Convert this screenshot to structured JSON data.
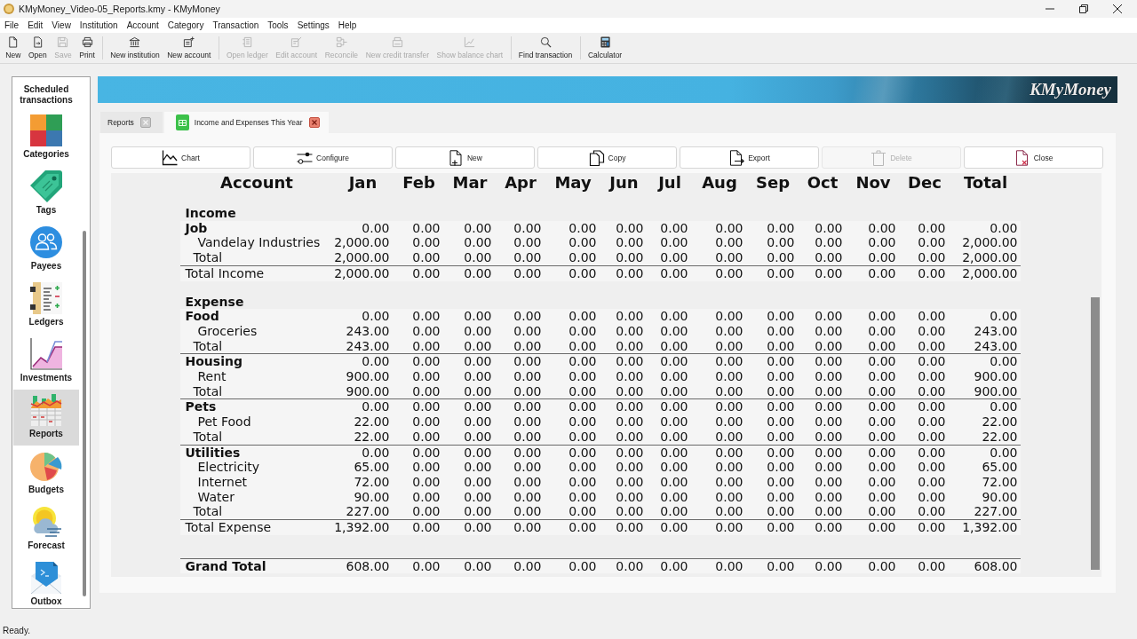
{
  "window": {
    "title": "KMyMoney_Video-05_Reports.kmy - KMyMoney"
  },
  "menu": [
    "File",
    "Edit",
    "View",
    "Institution",
    "Account",
    "Category",
    "Transaction",
    "Tools",
    "Settings",
    "Help"
  ],
  "toolbar": [
    [
      {
        "label": "New",
        "disabled": false
      },
      {
        "label": "Open",
        "disabled": false
      },
      {
        "label": "Save",
        "disabled": true
      },
      {
        "label": "Print",
        "disabled": false
      }
    ],
    [
      {
        "label": "New institution",
        "disabled": false
      },
      {
        "label": "New account",
        "disabled": false
      }
    ],
    [
      {
        "label": "Open ledger",
        "disabled": true
      },
      {
        "label": "Edit account",
        "disabled": true
      },
      {
        "label": "Reconcile",
        "disabled": true
      },
      {
        "label": "New credit transfer",
        "disabled": true
      },
      {
        "label": "Show balance chart",
        "disabled": true
      }
    ],
    [
      {
        "label": "Find transaction",
        "disabled": false
      }
    ],
    [
      {
        "label": "Calculator",
        "disabled": false
      }
    ]
  ],
  "sidebar": {
    "items": [
      {
        "label": "Scheduled transactions",
        "selected": false
      },
      {
        "label": "Categories",
        "selected": false
      },
      {
        "label": "Tags",
        "selected": false
      },
      {
        "label": "Payees",
        "selected": false
      },
      {
        "label": "Ledgers",
        "selected": false
      },
      {
        "label": "Investments",
        "selected": false
      },
      {
        "label": "Reports",
        "selected": true
      },
      {
        "label": "Budgets",
        "selected": false
      },
      {
        "label": "Forecast",
        "selected": false
      },
      {
        "label": "Outbox",
        "selected": false
      }
    ]
  },
  "banner": {
    "logo": "KMyMoney"
  },
  "tabs": [
    {
      "label": "Reports",
      "kind": "overview",
      "selected": false
    },
    {
      "label": "Income and Expenses This Year",
      "kind": "report",
      "selected": true
    }
  ],
  "report_buttons": [
    {
      "label": "Chart",
      "disabled": false
    },
    {
      "label": "Configure",
      "disabled": false
    },
    {
      "label": "New",
      "disabled": false
    },
    {
      "label": "Copy",
      "disabled": false
    },
    {
      "label": "Export",
      "disabled": false
    },
    {
      "label": "Delete",
      "disabled": true
    },
    {
      "label": "Close",
      "disabled": false
    }
  ],
  "report": {
    "columns": [
      "Account",
      "Jan",
      "Feb",
      "Mar",
      "Apr",
      "May",
      "Jun",
      "Jul",
      "Aug",
      "Sep",
      "Oct",
      "Nov",
      "Dec",
      "Total"
    ],
    "rows": [
      {
        "kind": "section",
        "label": "Income"
      },
      {
        "kind": "group",
        "label": "Job",
        "values": [
          "0.00",
          "0.00",
          "0.00",
          "0.00",
          "0.00",
          "0.00",
          "0.00",
          "0.00",
          "0.00",
          "0.00",
          "0.00",
          "0.00",
          "0.00"
        ]
      },
      {
        "kind": "item",
        "label": "Vandelay Industries",
        "values": [
          "2,000.00",
          "0.00",
          "0.00",
          "0.00",
          "0.00",
          "0.00",
          "0.00",
          "0.00",
          "0.00",
          "0.00",
          "0.00",
          "0.00",
          "2,000.00"
        ]
      },
      {
        "kind": "subtotal",
        "label": "Total",
        "values": [
          "2,000.00",
          "0.00",
          "0.00",
          "0.00",
          "0.00",
          "0.00",
          "0.00",
          "0.00",
          "0.00",
          "0.00",
          "0.00",
          "0.00",
          "2,000.00"
        ]
      },
      {
        "kind": "total",
        "label": "Total Income",
        "values": [
          "2,000.00",
          "0.00",
          "0.00",
          "0.00",
          "0.00",
          "0.00",
          "0.00",
          "0.00",
          "0.00",
          "0.00",
          "0.00",
          "0.00",
          "2,000.00"
        ]
      },
      {
        "kind": "section",
        "label": "Expense"
      },
      {
        "kind": "group",
        "label": "Food",
        "values": [
          "0.00",
          "0.00",
          "0.00",
          "0.00",
          "0.00",
          "0.00",
          "0.00",
          "0.00",
          "0.00",
          "0.00",
          "0.00",
          "0.00",
          "0.00"
        ]
      },
      {
        "kind": "item",
        "label": "Groceries",
        "values": [
          "243.00",
          "0.00",
          "0.00",
          "0.00",
          "0.00",
          "0.00",
          "0.00",
          "0.00",
          "0.00",
          "0.00",
          "0.00",
          "0.00",
          "243.00"
        ]
      },
      {
        "kind": "subtotal",
        "label": "Total",
        "values": [
          "243.00",
          "0.00",
          "0.00",
          "0.00",
          "0.00",
          "0.00",
          "0.00",
          "0.00",
          "0.00",
          "0.00",
          "0.00",
          "0.00",
          "243.00"
        ]
      },
      {
        "kind": "group",
        "label": "Housing",
        "values": [
          "0.00",
          "0.00",
          "0.00",
          "0.00",
          "0.00",
          "0.00",
          "0.00",
          "0.00",
          "0.00",
          "0.00",
          "0.00",
          "0.00",
          "0.00"
        ]
      },
      {
        "kind": "item",
        "label": "Rent",
        "values": [
          "900.00",
          "0.00",
          "0.00",
          "0.00",
          "0.00",
          "0.00",
          "0.00",
          "0.00",
          "0.00",
          "0.00",
          "0.00",
          "0.00",
          "900.00"
        ]
      },
      {
        "kind": "subtotal",
        "label": "Total",
        "values": [
          "900.00",
          "0.00",
          "0.00",
          "0.00",
          "0.00",
          "0.00",
          "0.00",
          "0.00",
          "0.00",
          "0.00",
          "0.00",
          "0.00",
          "900.00"
        ]
      },
      {
        "kind": "group",
        "label": "Pets",
        "values": [
          "0.00",
          "0.00",
          "0.00",
          "0.00",
          "0.00",
          "0.00",
          "0.00",
          "0.00",
          "0.00",
          "0.00",
          "0.00",
          "0.00",
          "0.00"
        ]
      },
      {
        "kind": "item",
        "label": "Pet Food",
        "values": [
          "22.00",
          "0.00",
          "0.00",
          "0.00",
          "0.00",
          "0.00",
          "0.00",
          "0.00",
          "0.00",
          "0.00",
          "0.00",
          "0.00",
          "22.00"
        ]
      },
      {
        "kind": "subtotal",
        "label": "Total",
        "values": [
          "22.00",
          "0.00",
          "0.00",
          "0.00",
          "0.00",
          "0.00",
          "0.00",
          "0.00",
          "0.00",
          "0.00",
          "0.00",
          "0.00",
          "22.00"
        ]
      },
      {
        "kind": "group",
        "label": "Utilities",
        "values": [
          "0.00",
          "0.00",
          "0.00",
          "0.00",
          "0.00",
          "0.00",
          "0.00",
          "0.00",
          "0.00",
          "0.00",
          "0.00",
          "0.00",
          "0.00"
        ]
      },
      {
        "kind": "item",
        "label": "Electricity",
        "values": [
          "65.00",
          "0.00",
          "0.00",
          "0.00",
          "0.00",
          "0.00",
          "0.00",
          "0.00",
          "0.00",
          "0.00",
          "0.00",
          "0.00",
          "65.00"
        ]
      },
      {
        "kind": "item",
        "label": "Internet",
        "values": [
          "72.00",
          "0.00",
          "0.00",
          "0.00",
          "0.00",
          "0.00",
          "0.00",
          "0.00",
          "0.00",
          "0.00",
          "0.00",
          "0.00",
          "72.00"
        ]
      },
      {
        "kind": "item",
        "label": "Water",
        "values": [
          "90.00",
          "0.00",
          "0.00",
          "0.00",
          "0.00",
          "0.00",
          "0.00",
          "0.00",
          "0.00",
          "0.00",
          "0.00",
          "0.00",
          "90.00"
        ]
      },
      {
        "kind": "subtotal",
        "label": "Total",
        "values": [
          "227.00",
          "0.00",
          "0.00",
          "0.00",
          "0.00",
          "0.00",
          "0.00",
          "0.00",
          "0.00",
          "0.00",
          "0.00",
          "0.00",
          "227.00"
        ]
      },
      {
        "kind": "total",
        "label": "Total Expense",
        "values": [
          "1,392.00",
          "0.00",
          "0.00",
          "0.00",
          "0.00",
          "0.00",
          "0.00",
          "0.00",
          "0.00",
          "0.00",
          "0.00",
          "0.00",
          "1,392.00"
        ]
      },
      {
        "kind": "grand",
        "label": "Grand Total",
        "values": [
          "608.00",
          "0.00",
          "0.00",
          "0.00",
          "0.00",
          "0.00",
          "0.00",
          "0.00",
          "0.00",
          "0.00",
          "0.00",
          "0.00",
          "608.00"
        ]
      }
    ]
  },
  "status_bar": {
    "text": "Ready."
  }
}
